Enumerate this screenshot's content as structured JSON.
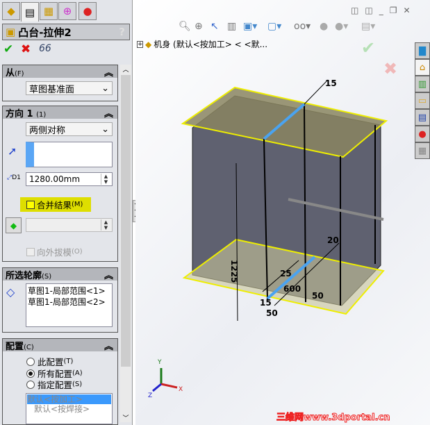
{
  "tabs": [
    "feature-manager",
    "property-manager",
    "configuration-manager",
    "dimxpert-manager",
    "display-manager"
  ],
  "title": "凸台-拉伸2",
  "help": "?",
  "actions": {
    "ok": "✔",
    "cancel": "✖",
    "preview": "66"
  },
  "from": {
    "header": "从",
    "key": "(F)",
    "value": "草图基准面"
  },
  "direction1": {
    "header": "方向 1",
    "key": "(1)",
    "end_condition": "两侧对称",
    "depth": "1280.00mm",
    "depth_label": "D1",
    "merge_result": "合并结果",
    "merge_key": "(M)",
    "merge_checked": false,
    "draft_outward": "向外拔模",
    "draft_key": "(O)"
  },
  "contours": {
    "header": "所选轮廓",
    "key": "(S)",
    "items": [
      "草图1-局部范围<1>",
      "草图1-局部范围<2>"
    ]
  },
  "config": {
    "header": "配置",
    "key": "(C)",
    "options": [
      {
        "label": "此配置",
        "key": "(T)"
      },
      {
        "label": "所有配置",
        "key": "(A)",
        "selected": true
      },
      {
        "label": "指定配置",
        "key": "(S)"
      }
    ],
    "list": [
      "默认<按加工>",
      "默认<按焊接>"
    ]
  },
  "tree": {
    "item": "机身 (默认<按加工> < <默..."
  },
  "dimensions": [
    "15",
    "1225",
    "25",
    "600",
    "20",
    "50",
    "50",
    "15"
  ],
  "triad": {
    "x": "X",
    "y": "Y",
    "z": "Z"
  },
  "watermark": "三维网www.3dportal.cn"
}
